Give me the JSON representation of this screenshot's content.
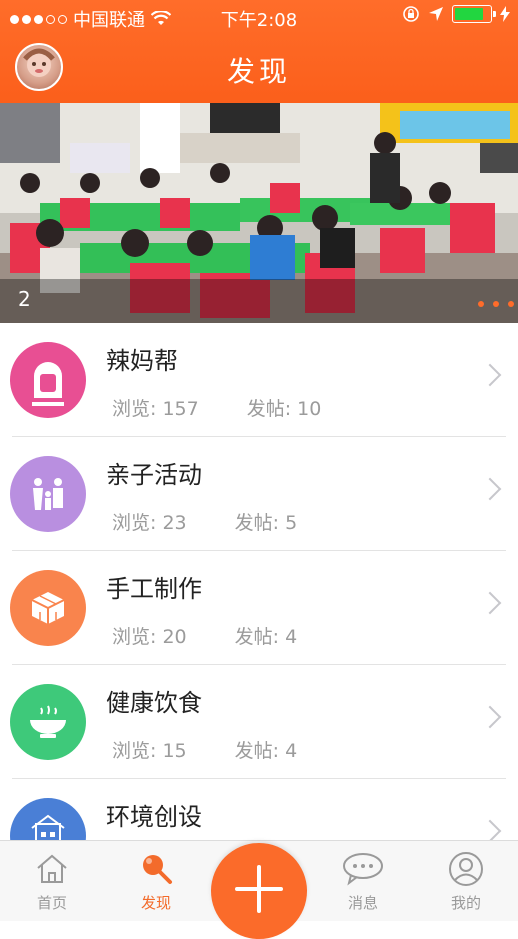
{
  "status_bar": {
    "carrier": "中国联通",
    "time": "下午2:08",
    "signal_bars_filled": 3,
    "signal_bars_total": 5,
    "battery_level": 0.8
  },
  "header": {
    "title": "发现"
  },
  "banner": {
    "index_label": "2",
    "pager_count": 3
  },
  "colors": {
    "accent": "#fb6b2a",
    "red_icon": "#e84f93",
    "purple_icon": "#b98fe0",
    "orange_icon": "#f9844d",
    "green_icon": "#3ec97a",
    "blue_icon": "#4a7fd6"
  },
  "list": {
    "items": [
      {
        "name": "辣妈帮",
        "views_label": "浏览: 157",
        "posts_label": "发帖: 10",
        "icon": "mom-icon",
        "color": "#e84f93"
      },
      {
        "name": "亲子活动",
        "views_label": "浏览: 23",
        "posts_label": "发帖: 5",
        "icon": "family-icon",
        "color": "#b98fe0"
      },
      {
        "name": "手工制作",
        "views_label": "浏览: 20",
        "posts_label": "发帖: 4",
        "icon": "cube-icon",
        "color": "#f9844d"
      },
      {
        "name": "健康饮食",
        "views_label": "浏览: 15",
        "posts_label": "发帖: 4",
        "icon": "bowl-icon",
        "color": "#3ec97a"
      },
      {
        "name": "环境创设",
        "views_label": "",
        "posts_label": "",
        "icon": "building-icon",
        "color": "#4a7fd6"
      }
    ]
  },
  "tabbar": {
    "home": "首页",
    "discover": "发现",
    "messages": "消息",
    "mine": "我的"
  }
}
